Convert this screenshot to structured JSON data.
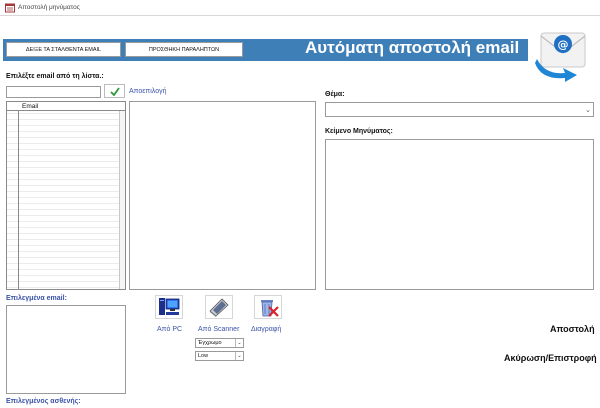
{
  "window": {
    "title": "Αποστολή μηνύματος",
    "icon": "form-icon"
  },
  "header": {
    "show_sent_button": "ΔΕΙΞΕ ΤΑ ΣΤΑΛΘΕΝΤΑ EMAIL",
    "add_recipients_button": "ΠΡΟΣΘΗΚΗ ΠΑΡΑΛΗΠΤΩΝ",
    "title": "Αυτόματη αποστολή email",
    "logo_icon": "email-envelope-icon",
    "banner_color": "#3f7fb8"
  },
  "email_picker": {
    "label": "Επιλέξτε email από τη λίστα.:",
    "input_value": "",
    "confirm_icon": "checkmark-icon",
    "deselect_label": "Αποεπιλογή",
    "grid_column": "Email"
  },
  "selected_emails": {
    "label": "Επιλεγμένα email:"
  },
  "selected_patient": {
    "label": "Επιλεγμένος ασθενής:"
  },
  "subject": {
    "label": "Θέμα:",
    "value": ""
  },
  "message": {
    "label": "Κείμενο Μηνύματος:",
    "value": ""
  },
  "attachments": {
    "from_pc": {
      "label": "Από PC",
      "icon": "computer-icon"
    },
    "from_scanner": {
      "label": "Από Scanner",
      "icon": "scanner-icon"
    },
    "delete": {
      "label": "Διαγραφή",
      "icon": "delete-icon"
    },
    "color_mode": "Έγχρωμο",
    "quality": "Low"
  },
  "actions": {
    "send": "Αποστολή",
    "cancel": "Ακύρωση/Επιστροφή"
  }
}
